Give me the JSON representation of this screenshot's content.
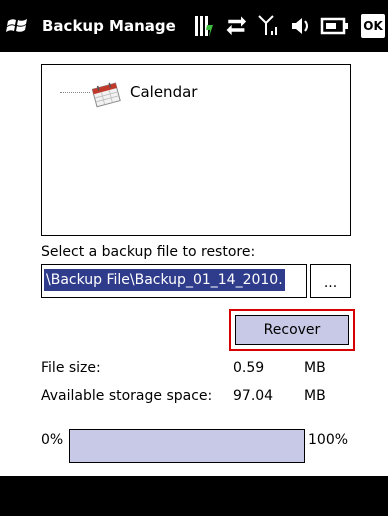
{
  "titlebar": {
    "title": "Backup Manage",
    "ok_label": "OK",
    "icons": [
      "windows-start-icon",
      "battery-charging-icon",
      "sync-arrows-icon",
      "signal-icon",
      "volume-icon",
      "battery-icon"
    ]
  },
  "tree": {
    "items": [
      {
        "label": "Calendar",
        "icon": "calendar-icon"
      }
    ]
  },
  "restore": {
    "select_label": "Select a backup file to restore:",
    "path_value": "\\Backup File\\Backup_01_14_2010.",
    "browse_label": "...",
    "recover_label": "Recover"
  },
  "info": {
    "file_size_label": "File size:",
    "file_size_value": "0.59",
    "file_size_unit": "MB",
    "storage_label": "Available storage space:",
    "storage_value": "97.04",
    "storage_unit": "MB"
  },
  "progress": {
    "min_label": "0%",
    "max_label": "100%",
    "value": 0
  },
  "colors": {
    "selection": "#2f3c8c",
    "button_face": "#c7c9e6",
    "highlight_border": "#d60000"
  }
}
